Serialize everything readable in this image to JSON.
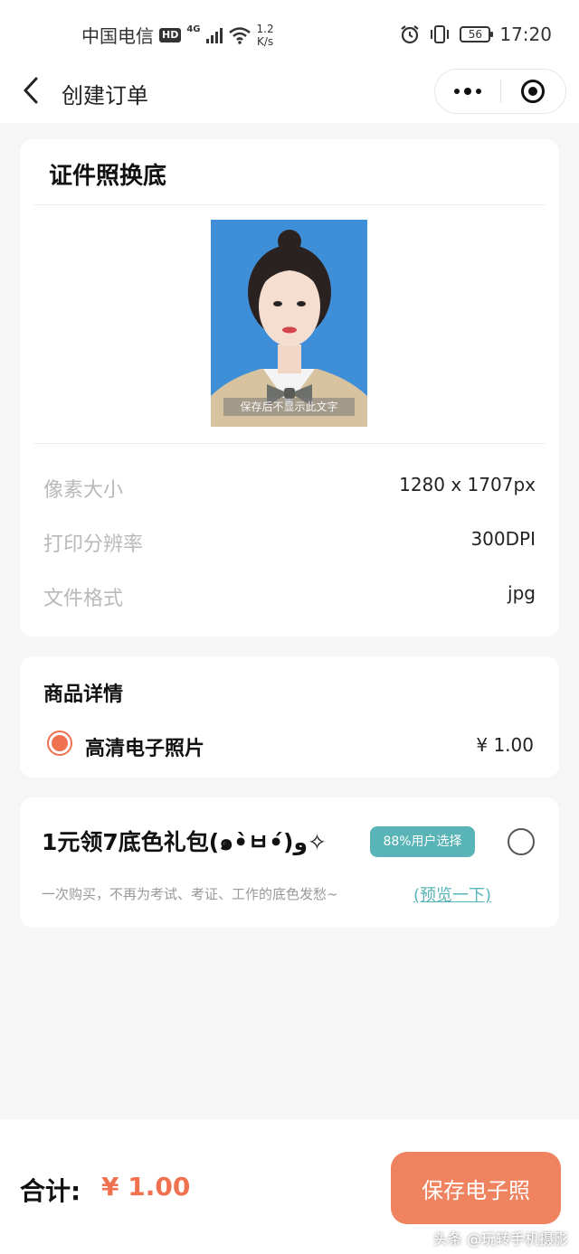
{
  "statusbar": {
    "carrier": "中国电信",
    "hd": "HD",
    "network": "4G",
    "speed_value": "1.2",
    "speed_unit": "K/s",
    "battery": "56",
    "time": "17:20"
  },
  "navbar": {
    "title": "创建订单"
  },
  "photo_card": {
    "title": "证件照换底",
    "photo_caption": "保存后不显示此文字",
    "background_color": "#3f8fd8",
    "specs": [
      {
        "label": "像素大小",
        "value": "1280 x 1707px"
      },
      {
        "label": "打印分辨率",
        "value": "300DPI"
      },
      {
        "label": "文件格式",
        "value": "jpg"
      }
    ]
  },
  "product_card": {
    "title": "商品详情",
    "item_name": "高清电子照片",
    "item_price": "¥ 1.00",
    "selected": true
  },
  "gift_card": {
    "title": "1元领7底色礼包(๑•̀ㅂ•́)و✧",
    "badge": "88%用户选择",
    "description": "一次购买，不再为考试、考证、工作的底色发愁~",
    "preview_link": "(预览一下)",
    "selected": false
  },
  "bottom": {
    "total_label": "合计:",
    "total_amount": "¥ 1.00",
    "save_button": "保存电子照"
  },
  "watermark": "头条 @玩转手机摄影",
  "colors": {
    "accent": "#f0714f",
    "teal": "#58b4b6",
    "page_bg": "#f6f6f6"
  }
}
